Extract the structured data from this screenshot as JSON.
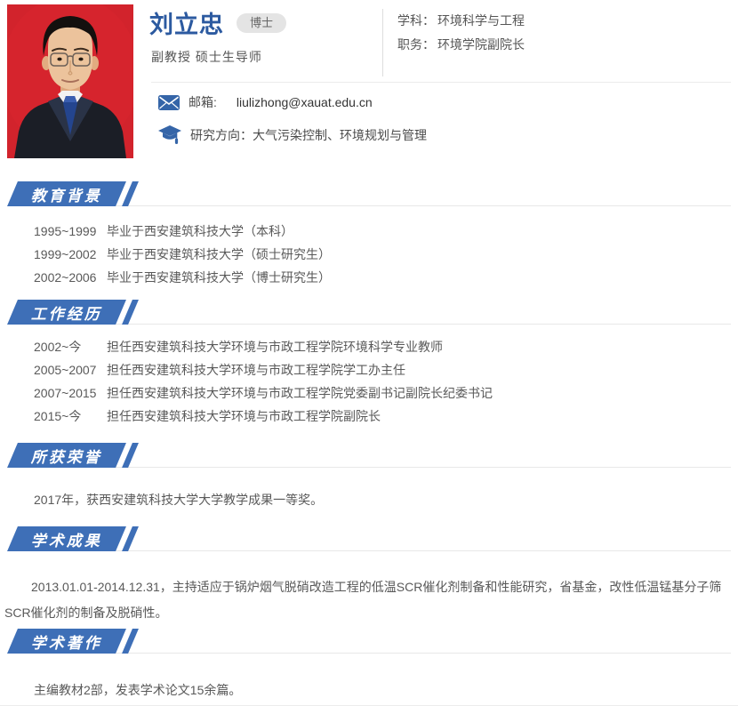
{
  "profile": {
    "name": "刘立忠",
    "degree_badge": "博士",
    "titles": "副教授  硕士生导师",
    "discipline_label": "学科：",
    "discipline_value": "环境科学与工程",
    "position_label": "职务：",
    "position_value": "环境学院副院长",
    "email_label": "邮箱:",
    "email_value": "liulizhong@xauat.edu.cn",
    "research_label": "研究方向：",
    "research_value": "大气污染控制、环境规划与管理",
    "photo_alt": "id-photo-red-background"
  },
  "sections": {
    "education": {
      "title": "教育背景",
      "items": [
        {
          "time": "1995~1999",
          "desc": "毕业于西安建筑科技大学（本科）"
        },
        {
          "time": "1999~2002",
          "desc": "毕业于西安建筑科技大学（硕士研究生）"
        },
        {
          "time": "2002~2006",
          "desc": "毕业于西安建筑科技大学（博士研究生）"
        }
      ]
    },
    "work": {
      "title": "工作经历",
      "items": [
        {
          "time": "2002~今",
          "desc": "担任西安建筑科技大学环境与市政工程学院环境科学专业教师"
        },
        {
          "time": "2005~2007",
          "desc": "担任西安建筑科技大学环境与市政工程学院学工办主任"
        },
        {
          "time": "2007~2015",
          "desc": "担任西安建筑科技大学环境与市政工程学院党委副书记副院长纪委书记"
        },
        {
          "time": "2015~今",
          "desc": "担任西安建筑科技大学环境与市政工程学院副院长"
        }
      ]
    },
    "honors": {
      "title": "所获荣誉",
      "text": "2017年，获西安建筑科技大学大学教学成果一等奖。"
    },
    "achievements": {
      "title": "学术成果",
      "text": "2013.01.01-2014.12.31，主持适应于锅炉烟气脱硝改造工程的低温SCR催化剂制备和性能研究，省基金，改性低温锰基分子筛SCR催化剂的制备及脱硝性。"
    },
    "publications": {
      "title": "学术著作",
      "text": "主编教材2部，发表学术论文15余篇。"
    }
  },
  "colors": {
    "accent_blue": "#3e6fb7",
    "name_blue": "#2c5aa0",
    "photo_red": "#d2232c",
    "badge_gray": "#e4e4e4"
  }
}
